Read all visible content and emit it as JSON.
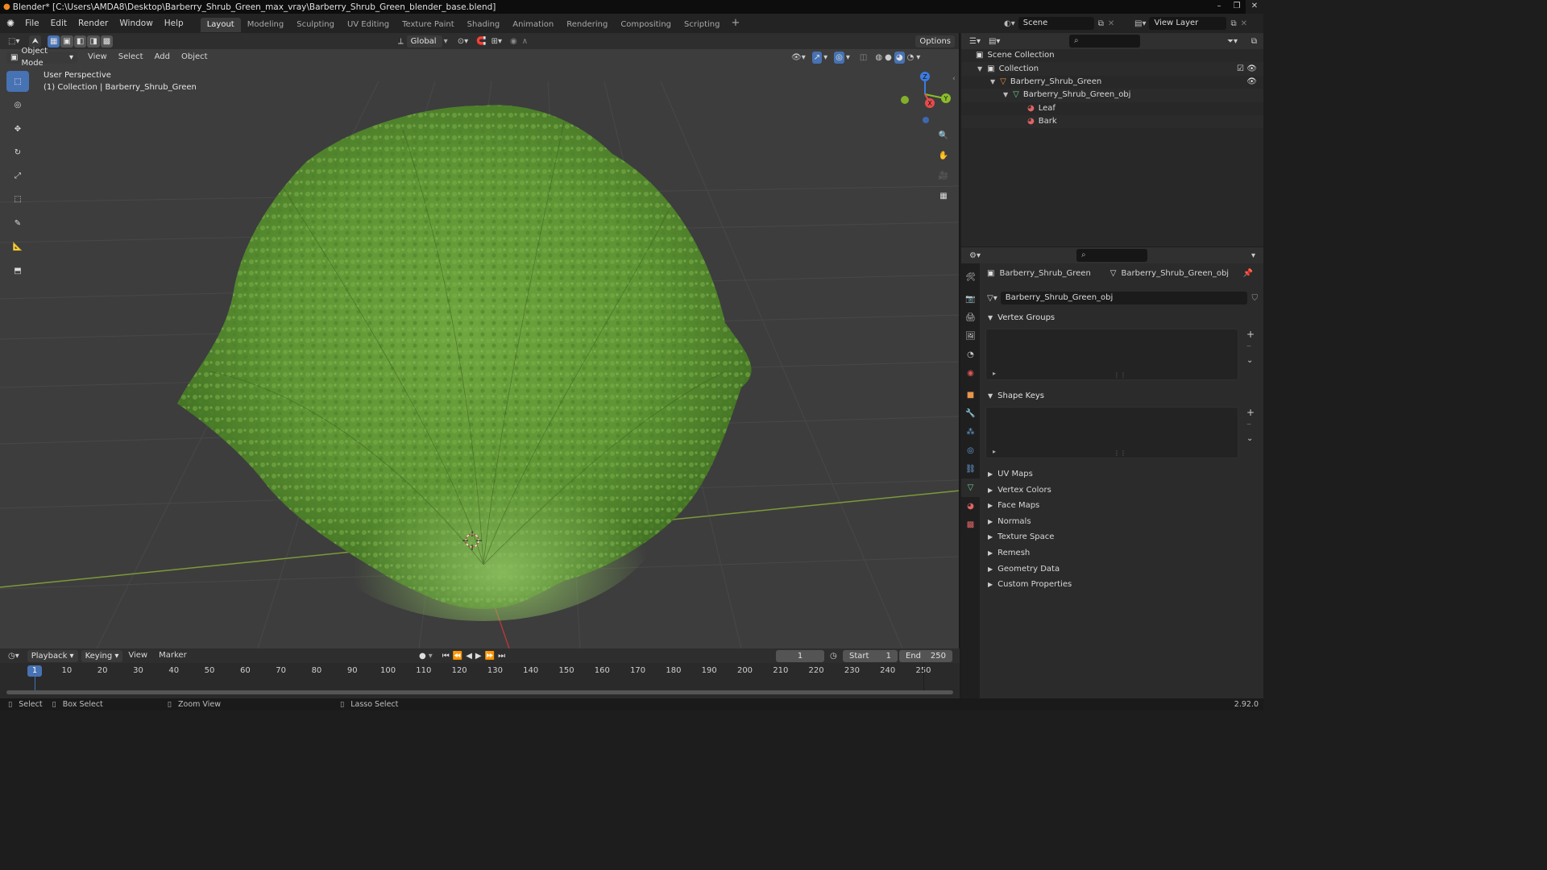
{
  "window": {
    "title": "Blender* [C:\\Users\\AMDA8\\Desktop\\Barberry_Shrub_Green_max_vray\\Barberry_Shrub_Green_blender_base.blend]"
  },
  "menus": [
    "File",
    "Edit",
    "Render",
    "Window",
    "Help"
  ],
  "workspaces": [
    "Layout",
    "Modeling",
    "Sculpting",
    "UV Editing",
    "Texture Paint",
    "Shading",
    "Animation",
    "Rendering",
    "Compositing",
    "Scripting"
  ],
  "active_workspace": "Layout",
  "scene": {
    "name": "Scene",
    "view_layer": "View Layer"
  },
  "viewport": {
    "transform_orientation": "Global",
    "options_label": "Options",
    "mode": "Object Mode",
    "header_menus": [
      "View",
      "Select",
      "Add",
      "Object"
    ],
    "perspective_label": "User Perspective",
    "collection_label": "(1) Collection | Barberry_Shrub_Green",
    "gizmo_axes": {
      "x": "X",
      "y": "Y",
      "z": "Z"
    }
  },
  "outliner": {
    "rows": [
      {
        "label": "Scene Collection",
        "indent": 0,
        "icon": "collection-icon"
      },
      {
        "label": "Collection",
        "indent": 1,
        "icon": "collection-icon"
      },
      {
        "label": "Barberry_Shrub_Green",
        "indent": 2,
        "icon": "object-icon"
      },
      {
        "label": "Barberry_Shrub_Green_obj",
        "indent": 3,
        "icon": "mesh-icon"
      },
      {
        "label": "Leaf",
        "indent": 4,
        "icon": "material-icon"
      },
      {
        "label": "Bark",
        "indent": 4,
        "icon": "material-icon"
      }
    ]
  },
  "properties": {
    "breadcrumb_object": "Barberry_Shrub_Green",
    "breadcrumb_mesh": "Barberry_Shrub_Green_obj",
    "mesh_name": "Barberry_Shrub_Green_obj",
    "panels_open": [
      "Vertex Groups",
      "Shape Keys"
    ],
    "panels_closed": [
      "UV Maps",
      "Vertex Colors",
      "Face Maps",
      "Normals",
      "Texture Space",
      "Remesh",
      "Geometry Data",
      "Custom Properties"
    ]
  },
  "timeline": {
    "menus": [
      "Playback",
      "Keying",
      "View",
      "Marker"
    ],
    "current_frame": "1",
    "start_label": "Start",
    "start_value": "1",
    "end_label": "End",
    "end_value": "250",
    "ticks": [
      "1",
      "10",
      "20",
      "30",
      "40",
      "50",
      "60",
      "70",
      "80",
      "90",
      "100",
      "110",
      "120",
      "130",
      "140",
      "150",
      "160",
      "170",
      "180",
      "190",
      "200",
      "210",
      "220",
      "230",
      "240",
      "250"
    ]
  },
  "statusbar": {
    "select": "Select",
    "box_select": "Box Select",
    "zoom_view": "Zoom View",
    "lasso_select": "Lasso Select",
    "version": "2.92.0"
  },
  "colors": {
    "accent": "#4772b3",
    "x_axis": "#e64c4c",
    "y_axis": "#8bbd2a",
    "z_axis": "#3d7be0",
    "foliage": "#6aa23a"
  }
}
